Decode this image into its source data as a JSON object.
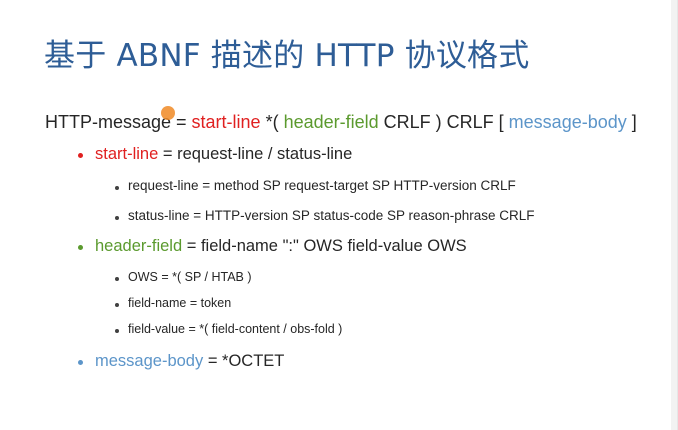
{
  "title": "基于 ABNF 描述的 HTTP 协议格式",
  "main_rule": {
    "lhs": "HTTP-message",
    "eq": " = ",
    "start_line": "start-line",
    "seg1": " *( ",
    "header_field": "header-field",
    "seg2": " CRLF ) CRLF [ ",
    "message_body": "message-body",
    "seg3": " ]"
  },
  "start_line_rule": {
    "name": "start-line",
    "rest": " = request-line / status-line",
    "children": [
      "request-line = method SP request-target SP HTTP-version CRLF",
      "status-line = HTTP-version SP status-code SP reason-phrase CRLF"
    ]
  },
  "header_field_rule": {
    "name": "header-field",
    "rest": " = field-name \":\" OWS field-value OWS",
    "children": [
      "OWS = *( SP / HTAB )",
      "field-name = token",
      "field-value = *( field-content / obs-fold )"
    ]
  },
  "message_body_rule": {
    "name": "message-body",
    "rest": " = *OCTET"
  },
  "colors": {
    "title": "#2e5d96",
    "start_line": "#e02020",
    "header_field": "#5b9a2e",
    "message_body": "#5c95c9",
    "cursor": "#f08a24"
  }
}
